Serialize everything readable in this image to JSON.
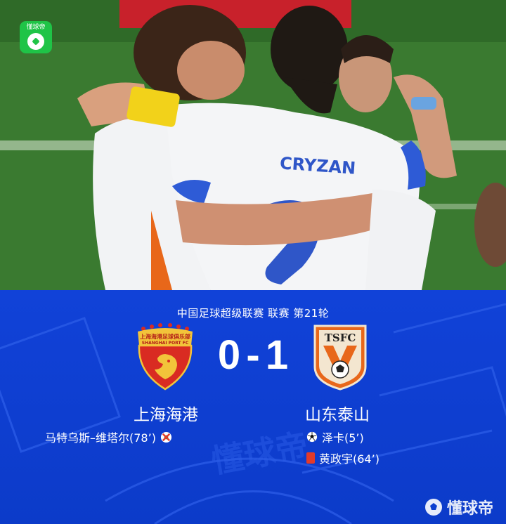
{
  "app": {
    "badge_text": "懂球帝",
    "badge_icon": "app-logo-icon"
  },
  "photo": {
    "jersey_name": "CRYZAN",
    "description_icon": "match-photo"
  },
  "match": {
    "competition": "中国足球超级联赛 联赛 第21轮",
    "home": {
      "name": "上海海港",
      "score": "0",
      "logo_text": "上海海港足球俱乐部",
      "logo_subtext": "SHANGHAI PORT FC",
      "events": [
        {
          "type": "own-goal",
          "text": "马特乌斯–维塔尔(78’)"
        }
      ]
    },
    "separator": "-",
    "away": {
      "name": "山东泰山",
      "score": "1",
      "logo_text": "TSFC",
      "events": [
        {
          "type": "goal",
          "text": "泽卡(5’)"
        },
        {
          "type": "red-card",
          "text": "黄政宇(64’)"
        }
      ]
    }
  },
  "watermark": {
    "text": "懂球帝"
  },
  "colors": {
    "board_blue": "#0c3fd0",
    "brand_green": "#1fc447",
    "card_red": "#e23a2a",
    "port_red": "#d92b22",
    "taishan_orange": "#e8671a"
  }
}
